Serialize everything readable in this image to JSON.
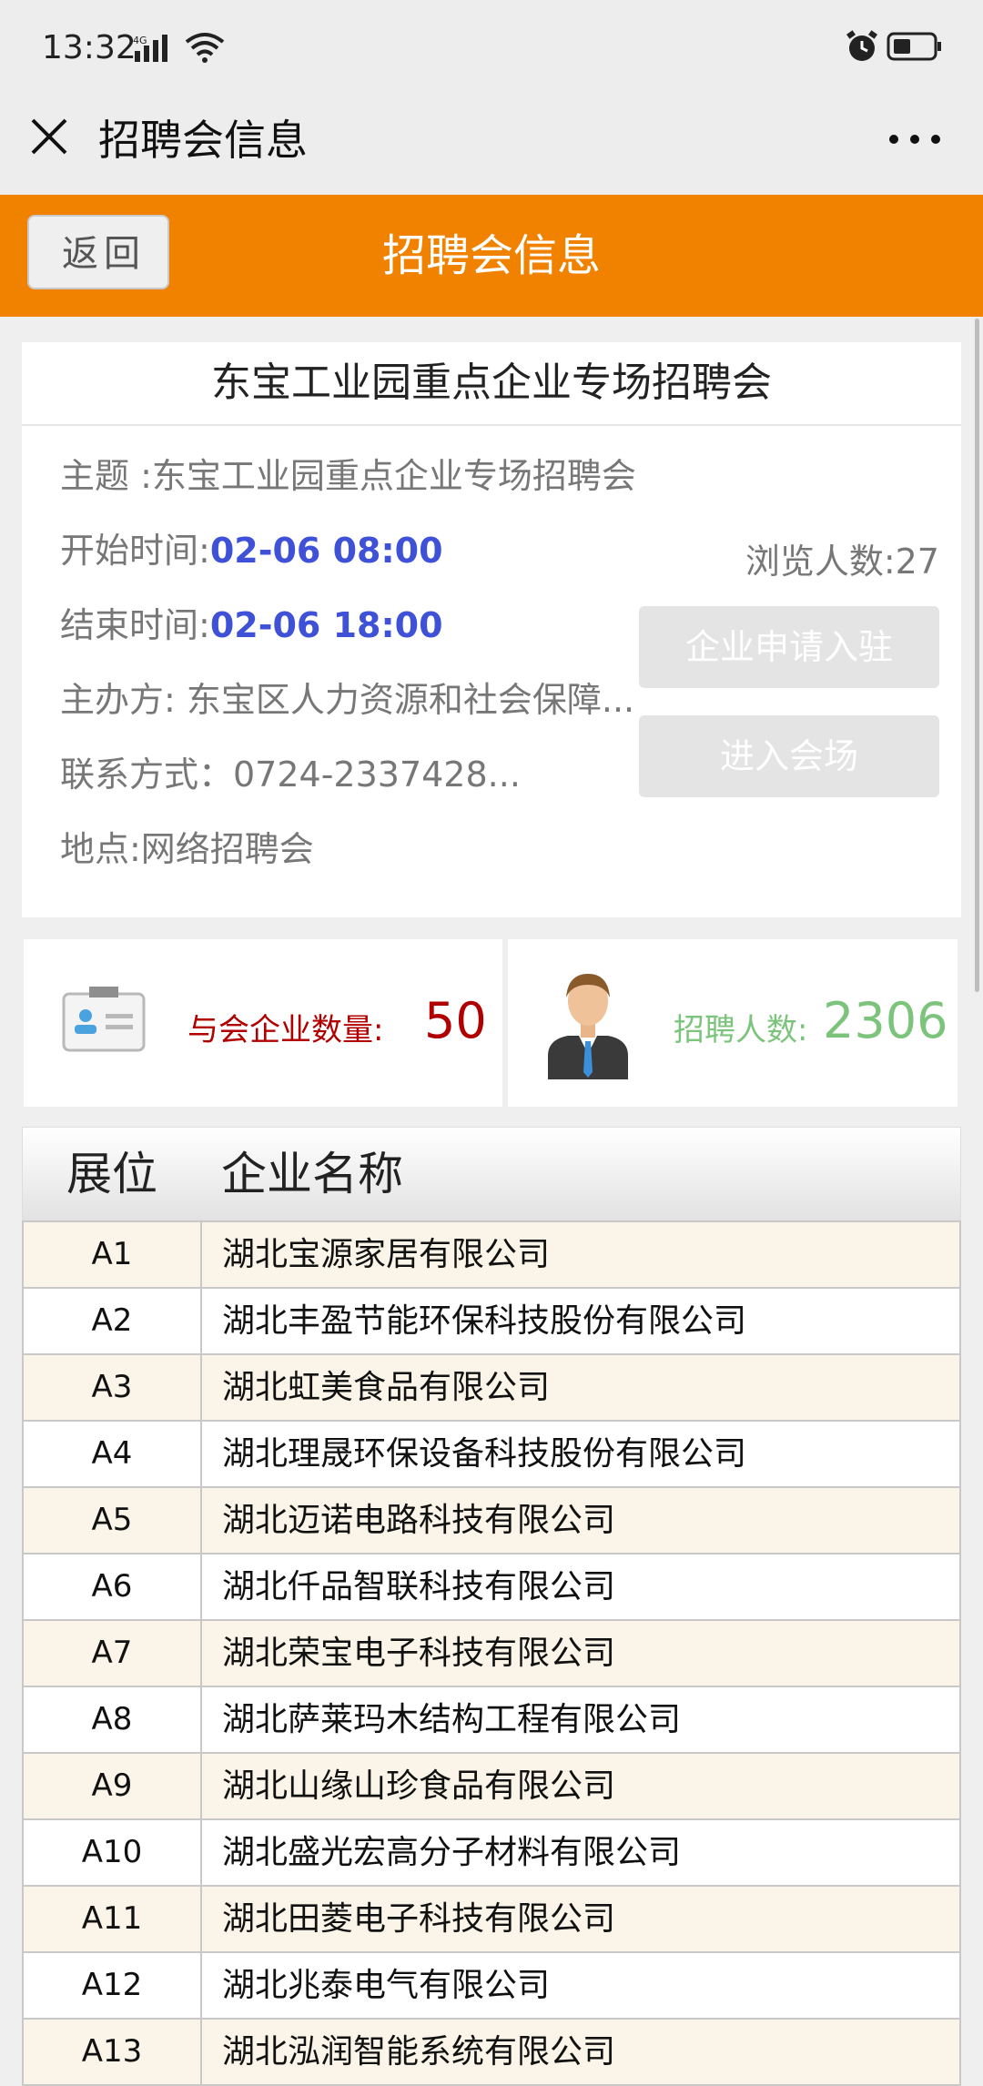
{
  "status": {
    "time": "13:32",
    "net": "4G"
  },
  "titlebar": {
    "title": "招聘会信息"
  },
  "header": {
    "back_label": "返回",
    "title": "招聘会信息"
  },
  "fair": {
    "name": "东宝工业园重点企业专场招聘会",
    "topic": "主题 :东宝工业园重点企业专场招聘会",
    "start_label": "开始时间:",
    "start_value": "02-06 08:00",
    "end_label": "结束时间:",
    "end_value": "02-06 18:00",
    "views": "浏览人数:27",
    "organizer": "主办方: 东宝区人力资源和社会保障...",
    "contact": "联系方式：0724-2337428...",
    "location": "地点:网络招聘会",
    "apply_button": "企业申请入驻",
    "enter_button": "进入会场"
  },
  "stats": {
    "companies_label": "与会企业数量:",
    "companies_value": "50",
    "recruit_label": "招聘人数:",
    "recruit_value": "2306"
  },
  "colors": {
    "accent": "#f08200",
    "blue": "#3f51d6",
    "red": "#b00000",
    "green": "#7cc47c"
  },
  "table": {
    "headers": [
      "展位",
      "企业名称"
    ],
    "rows": [
      [
        "A1",
        "湖北宝源家居有限公司"
      ],
      [
        "A2",
        "湖北丰盈节能环保科技股份有限公司"
      ],
      [
        "A3",
        "湖北虹美食品有限公司"
      ],
      [
        "A4",
        "湖北理晟环保设备科技股份有限公司"
      ],
      [
        "A5",
        "湖北迈诺电路科技有限公司"
      ],
      [
        "A6",
        "湖北仟品智联科技有限公司"
      ],
      [
        "A7",
        "湖北荣宝电子科技有限公司"
      ],
      [
        "A8",
        "湖北萨莱玛木结构工程有限公司"
      ],
      [
        "A9",
        "湖北山缘山珍食品有限公司"
      ],
      [
        "A10",
        "湖北盛光宏高分子材料有限公司"
      ],
      [
        "A11",
        "湖北田菱电子科技有限公司"
      ],
      [
        "A12",
        "湖北兆泰电气有限公司"
      ],
      [
        "A13",
        "湖北泓润智能系统有限公司"
      ]
    ]
  }
}
